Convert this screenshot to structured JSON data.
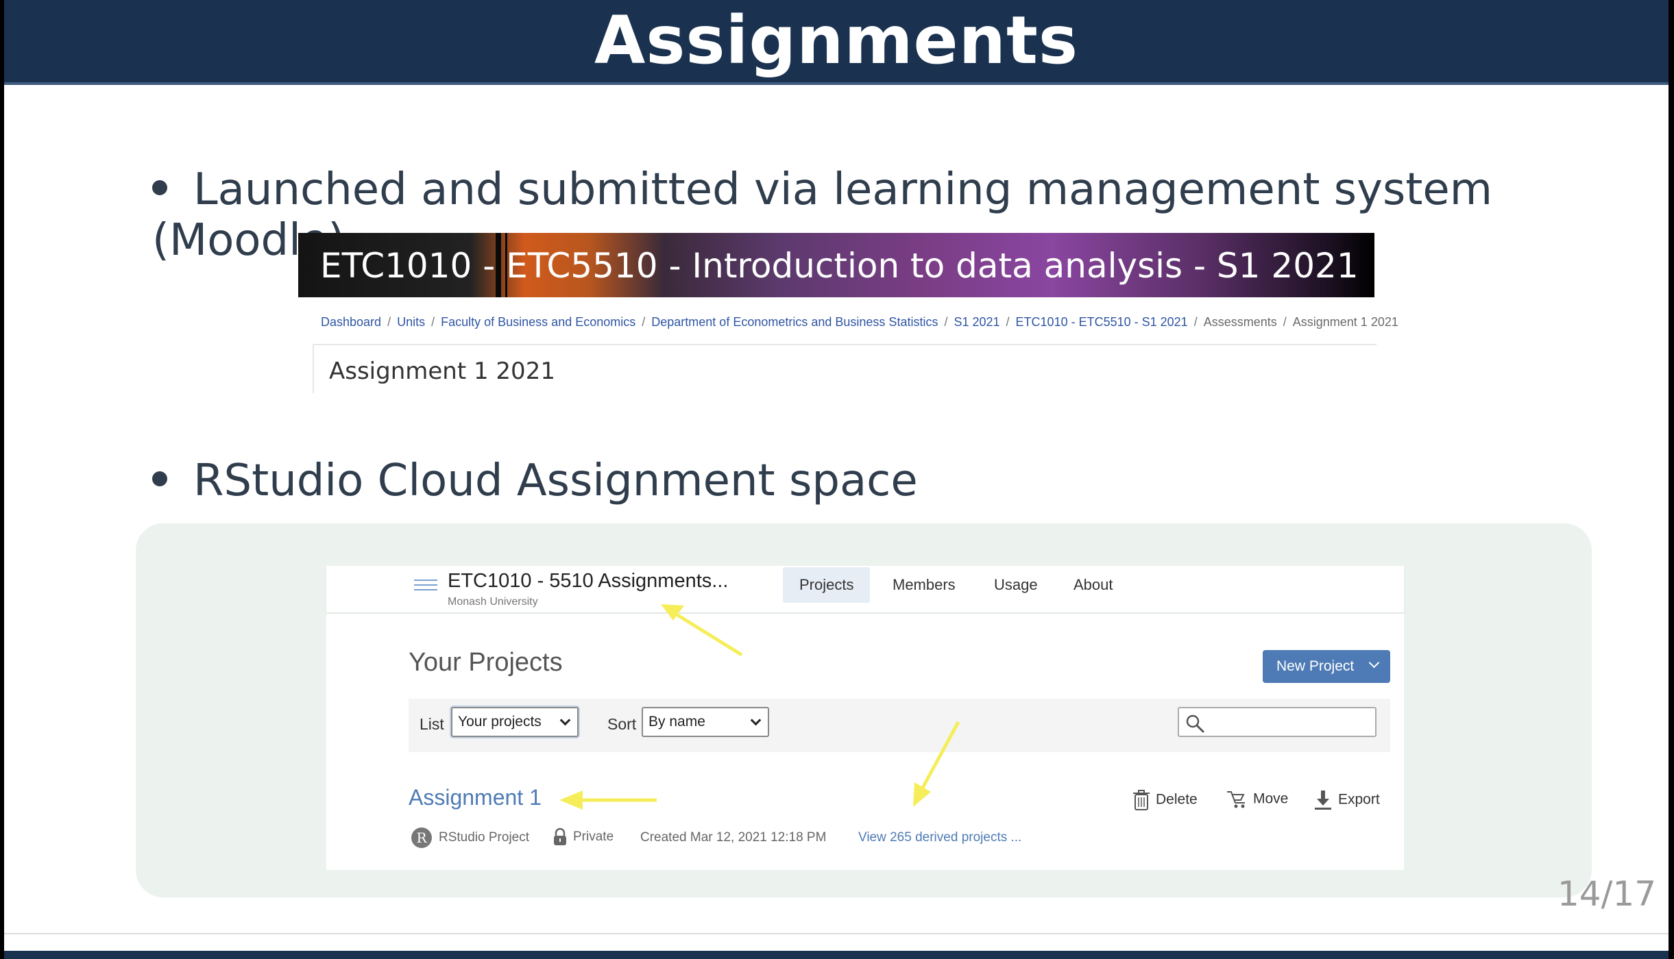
{
  "slide": {
    "title": "Assignments",
    "bullet1": "Launched and submitted via learning management system (Moodle)",
    "bullet2": "RStudio Cloud Assignment space",
    "page_number": "14/17"
  },
  "moodle": {
    "course_title": "ETC1010 - ETC5510 - Introduction to data analysis - S1 2021",
    "breadcrumb": [
      "Dashboard",
      "Units",
      "Faculty of Business and Economics",
      "Department of Econometrics and Business Statistics",
      "S1 2021",
      "ETC1010 - ETC5510 - S1 2021",
      "Assessments",
      "Assignment 1 2021"
    ],
    "separator": "/",
    "page_heading": "Assignment 1 2021"
  },
  "rstudio": {
    "space_name": "ETC1010 - 5510 Assignments...",
    "organization": "Monash University",
    "nav_tabs": [
      "Projects",
      "Members",
      "Usage",
      "About"
    ],
    "active_tab": "Projects",
    "heading": "Your Projects",
    "new_project_label": "New Project",
    "list_label": "List",
    "list_value": "Your projects",
    "sort_label": "Sort",
    "sort_value": "By name",
    "search_value": "",
    "project": {
      "name": "Assignment 1",
      "type_badge": "R",
      "type": "RStudio Project",
      "visibility": "Private",
      "created": "Created Mar 12, 2021 12:18 PM",
      "derived_link": "View 265 derived projects ..."
    },
    "actions": {
      "delete": "Delete",
      "move": "Move",
      "export": "Export"
    }
  },
  "colors": {
    "title_bar": "#1a3250",
    "rstudio_accent": "#4e7bb5",
    "annotation_arrow": "#f5ee5a",
    "panel_background": "#ecf2ee"
  }
}
